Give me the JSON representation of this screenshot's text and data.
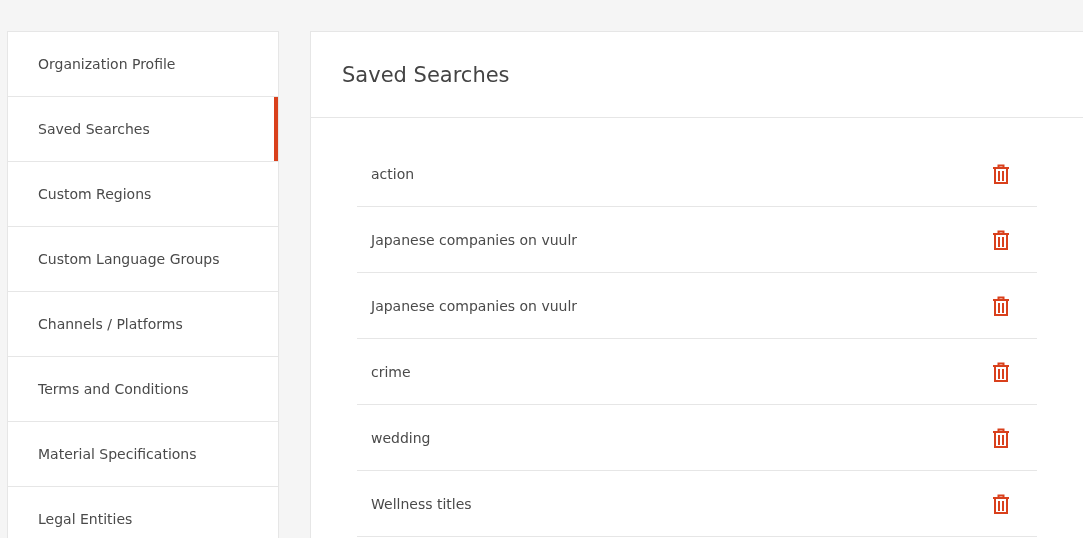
{
  "sidebar": {
    "items": [
      {
        "label": "Organization Profile",
        "selected": false
      },
      {
        "label": "Saved Searches",
        "selected": true
      },
      {
        "label": "Custom Regions",
        "selected": false
      },
      {
        "label": "Custom Language Groups",
        "selected": false
      },
      {
        "label": "Channels / Platforms",
        "selected": false
      },
      {
        "label": "Terms and Conditions",
        "selected": false
      },
      {
        "label": "Material Specifications",
        "selected": false
      },
      {
        "label": "Legal Entities",
        "selected": false
      }
    ]
  },
  "panel": {
    "title": "Saved Searches",
    "searches": [
      {
        "name": "action"
      },
      {
        "name": "Japanese companies on vuulr"
      },
      {
        "name": "Japanese companies on vuulr"
      },
      {
        "name": "crime"
      },
      {
        "name": "wedding"
      },
      {
        "name": "Wellness titles"
      }
    ]
  }
}
